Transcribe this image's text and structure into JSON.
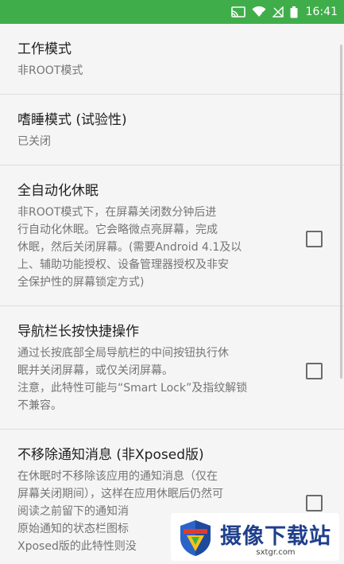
{
  "status_bar": {
    "time": "16:41",
    "icons": [
      "cast-icon",
      "wifi-icon",
      "no-signal-icon",
      "battery-icon"
    ],
    "background": "#3fae4a"
  },
  "settings": [
    {
      "title": "工作模式",
      "summary": "非ROOT模式",
      "checkbox": false
    },
    {
      "title": "嗜睡模式 (试验性)",
      "summary": "已关闭",
      "checkbox": false
    },
    {
      "title": "全自动化休眠",
      "summary": "非ROOT模式下，在屏幕关闭数分钟后进\n行自动化休眠。它会略微点亮屏幕，完成\n休眠，然后关闭屏幕。(需要Android 4.1及以\n上、辅助功能授权、设备管理器授权及非安\n全保护性的屏幕锁定方式)",
      "checkbox": true,
      "checked": false
    },
    {
      "title": "导航栏长按快捷操作",
      "summary": "通过长按底部全局导航栏的中间按钮执行休\n眠并关闭屏幕，或仅关闭屏幕。\n注意，此特性可能与“Smart Lock”及指纹解锁\n不兼容。",
      "checkbox": true,
      "checked": false
    },
    {
      "title": "不移除通知消息 (非Xposed版)",
      "summary": "在休眠时不移除该应用的通知消息（仅在\n屏幕关闭期间），这样在应用休眠后仍然可\n阅读之前留下的通知消\n原始通知的状态栏图标\nXposed版的此特性则没",
      "checkbox": true,
      "checked": false
    }
  ],
  "watermark": {
    "title": "摄像下载站",
    "url": "sxtgr.com"
  }
}
